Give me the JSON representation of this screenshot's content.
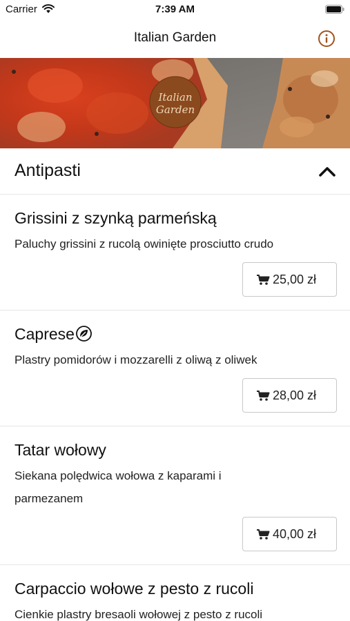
{
  "status_bar": {
    "carrier": "Carrier",
    "time": "7:39 AM"
  },
  "nav": {
    "title": "Italian Garden",
    "info_icon": "info-icon"
  },
  "hero": {
    "logo_text_line1": "Italian",
    "logo_text_line2": "Garden"
  },
  "section": {
    "title": "Antipasti",
    "expanded": true
  },
  "items": [
    {
      "name": "Grissini z szynką parmeńską",
      "description": "Paluchy grissini z rucolą owinięte prosciutto crudo",
      "price": "25,00 zł"
    },
    {
      "name": "Caprese",
      "vegetarian_icon": "leaf-icon",
      "description": "Plastry pomidorów i mozzarelli z oliwą z oliwek",
      "price": "28,00 zł"
    },
    {
      "name": "Tatar wołowy",
      "description": "Siekana polędwica wołowa z kaparami i parmezanem",
      "price": "40,00 zł"
    },
    {
      "name": "Carpaccio wołowe z pesto z rucoli",
      "description": "Cienkie plastry bresaoli wołowej z pesto z rucoli"
    }
  ],
  "colors": {
    "accent": "#a0521d",
    "divider": "#e5e5e5",
    "button_border": "#c8c8c8"
  }
}
